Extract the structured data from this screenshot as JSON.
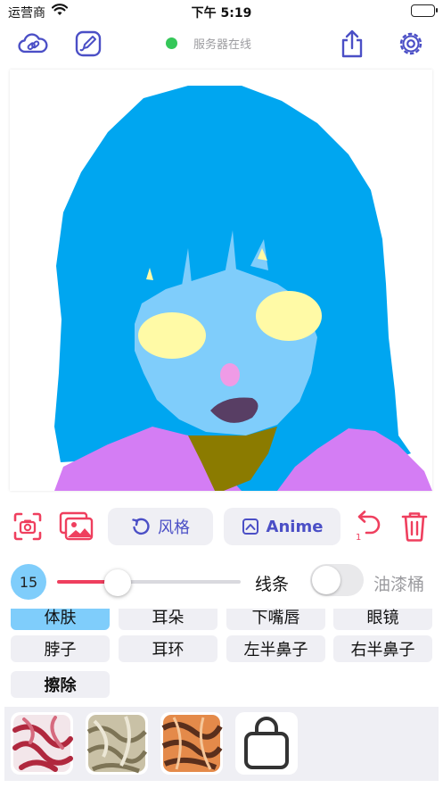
{
  "status_bar": {
    "carrier": "运营商",
    "time": "下午 5:19"
  },
  "toolbar": {
    "server_status": "服务器在线"
  },
  "actions": {
    "style_label": "风格",
    "anime_label": "Anime",
    "undo_count": "1"
  },
  "brush": {
    "size": "15",
    "size_fraction": 0.3,
    "line_label": "线条",
    "bucket_label": "油漆桶",
    "bucket_on": false
  },
  "parts": {
    "row1": [
      "体肤",
      "耳朵",
      "下嘴唇",
      "眼镜"
    ],
    "row2": [
      "脖子",
      "耳环",
      "左半鼻子",
      "右半鼻子"
    ],
    "row3": [
      "擦除"
    ],
    "selected": "体肤"
  },
  "textures": [
    "red-texture",
    "metal-texture",
    "orange-texture",
    "shop-bag-icon"
  ],
  "colors": {
    "accent": "#4b4fc6",
    "danger": "#ef3f5e",
    "hair": "#00a6f0",
    "skin": "#7fcdfb",
    "eyes": "#fffaa6",
    "shirt": "#d47df4",
    "neck": "#8b7b00",
    "mouth": "#583e64",
    "nose": "#ef9be6"
  }
}
